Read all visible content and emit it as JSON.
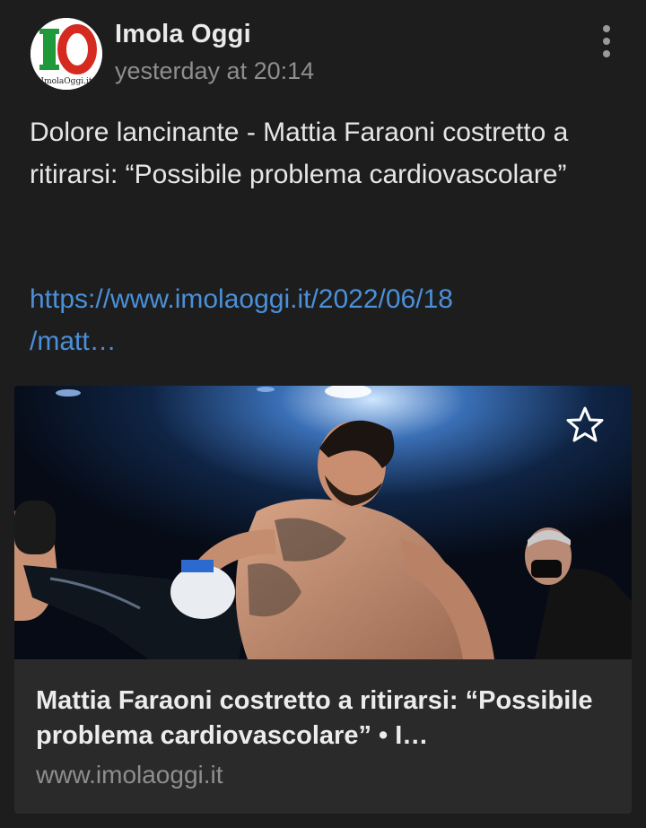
{
  "post": {
    "author": "Imola Oggi",
    "timestamp": "yesterday at 20:14",
    "text": "Dolore lancinante - Mattia Faraoni costretto a ritirarsi: “Possibile problema cardiovascolare”",
    "link": "https://www.imolaoggi.it/2022/06/18\n/matt…"
  },
  "avatar": {
    "logo_letters": "IO",
    "logo_caption": "ImolaOggi.it"
  },
  "card": {
    "title": "Mattia Faraoni costretto a ritirarsi: “Possibile problema cardiovascolare” • I…",
    "domain": "www.imolaoggi.it"
  },
  "icons": {
    "menu": "more-vertical-icon",
    "favorite": "star-outline-icon"
  },
  "colors": {
    "background": "#1d1d1d",
    "card": "#2a2a2a",
    "link": "#4a90d9",
    "muted": "#8e8e8e"
  }
}
